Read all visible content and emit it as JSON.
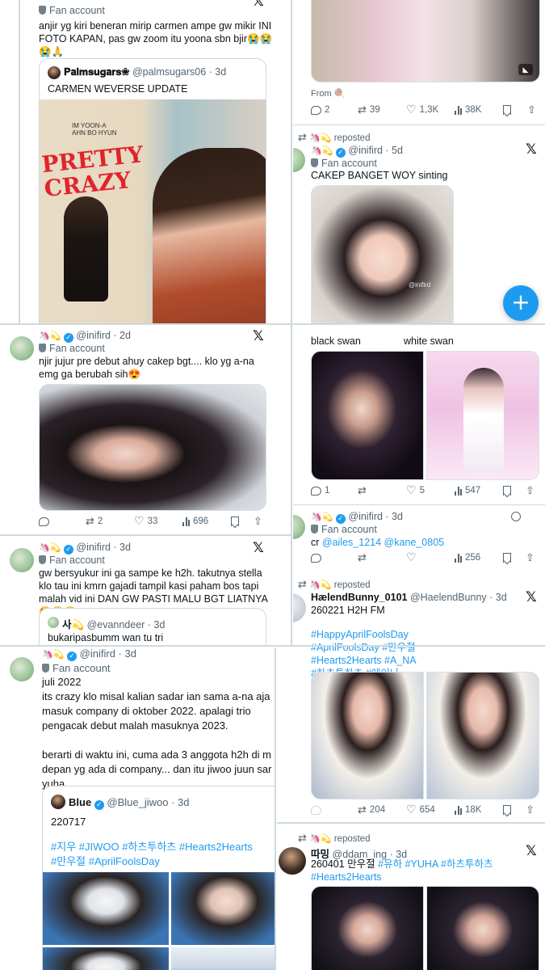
{
  "colors": {
    "accent": "#1d9bf0",
    "text": "#0f1419",
    "muted": "#536471",
    "divider": "#cfd9de"
  },
  "p1": {
    "fan_account": "Fan account",
    "text": "anjir yg kiri beneran mirip carmen ampe gw mikir INI FOTO KAPAN, pas gw zoom itu yoona sbn bjir😭😭\n😭🙏",
    "quote": {
      "name": "𝐏𝐚𝐥𝐦𝐬𝐮𝐠𝐚𝐫𝐬❀",
      "meta": "@palmsugars06 · 3d",
      "text": "CARMEN WEVERSE UPDATE",
      "poster_title": "PRETTY CRAZY",
      "poster_names": "IM YOON-A\nAHN BO HYUN"
    }
  },
  "p2": {
    "from_label": "From 🍭",
    "stats": {
      "replies": "2",
      "reposts": "39",
      "likes": "1,3K",
      "views": "38K"
    },
    "repost": {
      "label": "reposted",
      "handle": "@inifird · 5d",
      "fan_account": "Fan account",
      "text": "CAKEP BANGET WOY sinting",
      "watermark": "@inifird"
    },
    "fab_label": "+"
  },
  "p3": {
    "handle": "@inifird · 2d",
    "fan_account": "Fan account",
    "text": "njir jujur pre debut ahuy cakep bgt.... klo yg a-na emg ga berubah sih😍",
    "stats": {
      "reposts": "2",
      "likes": "33",
      "views": "696"
    }
  },
  "p4": {
    "labels": {
      "left": "black swan",
      "right": "white swan"
    },
    "stats": {
      "replies": "1",
      "likes": "5",
      "views": "547"
    },
    "tweet2": {
      "handle": "@inifird · 3d",
      "fan_account": "Fan account",
      "text_prefix": "cr ",
      "mention1": "@ailes_1214",
      "mention2": "@kane_0805",
      "views": "256"
    }
  },
  "p5": {
    "handle": "@inifird · 3d",
    "fan_account": "Fan account",
    "text": "gw bersyukur ini ga sampe ke h2h. takutnya stella klo tau ini kmrn gajadi tampil kasi paham bos tapi malah vid ini DAN GW PASTI MALU BGT LIATNYA😭😭😭",
    "quote": {
      "name": "사💫",
      "meta": "@evanndeer · 3d",
      "text": "bukaripasbumm wan tu tri"
    }
  },
  "p6": {
    "repost_label": "reposted",
    "name": "HælendBunny_0101",
    "meta": "@HaelendBunny · 3d",
    "text": "260221 H2H FM",
    "hashtags": "#HappyAprilFoolsDay\n#AprilFoolsDay #만우절\n#Hearts2Hearts #A_NA\n#하츠투하츠 #에이나",
    "stats": {
      "reposts": "204",
      "likes": "654",
      "views": "18K"
    }
  },
  "p7": {
    "handle": "@inifird · 3d",
    "fan_account": "Fan account",
    "text": "juli 2022\nits crazy klo misal kalian sadar ian sama a-na aja masuk company di oktober 2022. apalagi trio pengacak debut malah masuknya 2023.\n\nberarti di waktu ini, cuma ada 3 anggota h2h di m depan yg ada di company... dan itu jiwoo juun sar yuha...",
    "quote": {
      "name": "Blue",
      "meta": "@Blue_jiwoo · 3d",
      "text": "220717",
      "hashtags": "#지우 #JIWOO #하츠투하츠 #Hearts2Hearts\n#만우절 #AprilFoolsDay"
    }
  },
  "p8": {
    "repost_label": "reposted",
    "name": "따밍",
    "meta": "@ddam_ing · 3d",
    "text_prefix": "260401 만우절 ",
    "hashtags": "#유하 #YUHA #하츠투하츠\n#Hearts2Hearts"
  }
}
